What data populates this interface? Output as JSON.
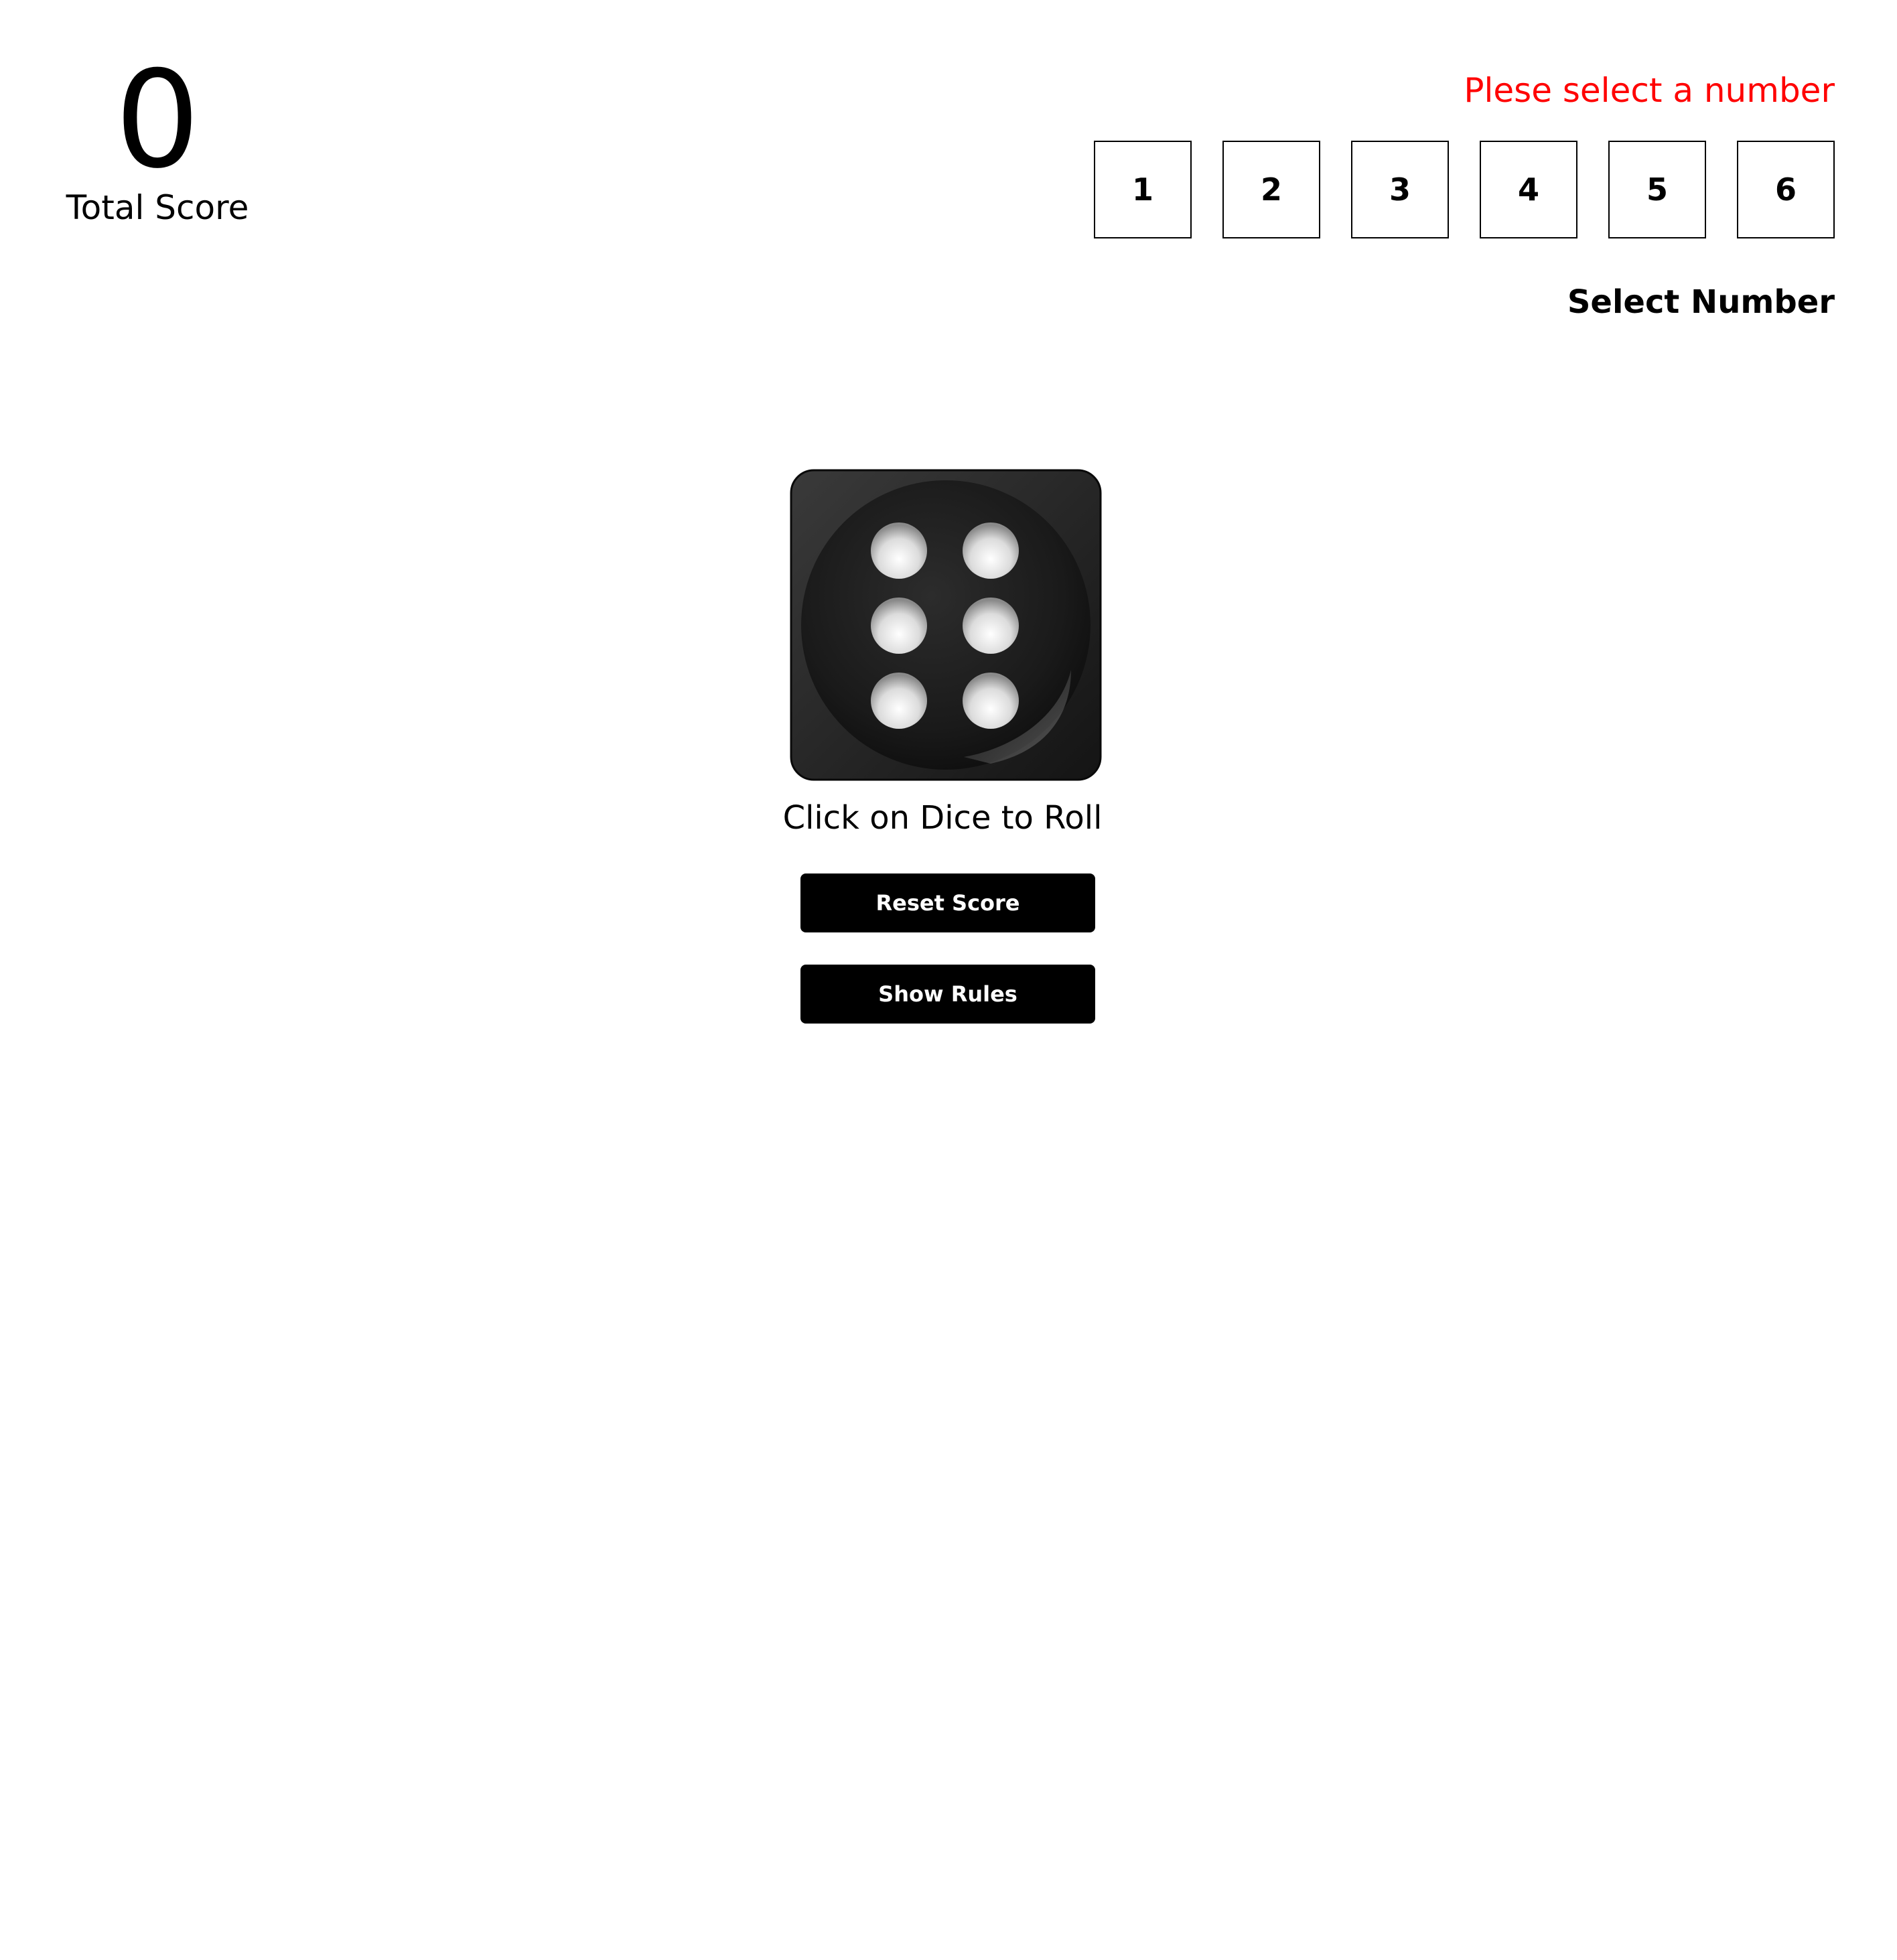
{
  "score": {
    "value": "0",
    "label": "Total Score"
  },
  "selector": {
    "error": "Plese select a number",
    "numbers": [
      "1",
      "2",
      "3",
      "4",
      "5",
      "6"
    ],
    "label": "Select Number"
  },
  "dice": {
    "face": 6,
    "hint": "Click on Dice to Roll"
  },
  "buttons": {
    "reset": "Reset Score",
    "rules": "Show Rules"
  },
  "colors": {
    "error": "#ff0000",
    "button_bg": "#000000",
    "button_text": "#ffffff"
  }
}
